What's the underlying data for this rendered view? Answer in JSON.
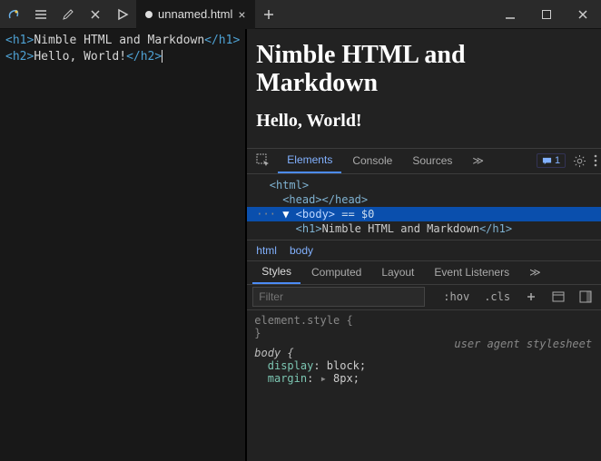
{
  "titlebar": {
    "tab_label": "unnamed.html",
    "tab_modified": true
  },
  "editor": {
    "lines": [
      {
        "open": "<h1>",
        "text": "Nimble HTML and Markdown",
        "close": "</h1>"
      },
      {
        "open": "<h2>",
        "text": "Hello, World!",
        "close": "</h2>"
      }
    ]
  },
  "preview": {
    "h1": "Nimble HTML and Markdown",
    "h2": "Hello, World!"
  },
  "devtools": {
    "tabs": [
      "Elements",
      "Console",
      "Sources"
    ],
    "active_tab": 0,
    "more_glyph": "≫",
    "message_count": "1",
    "dom": {
      "html_open": "<html>",
      "head": "<head></head>",
      "body_open": "<body>",
      "body_eq": " == $0",
      "h1_open": "<h1>",
      "h1_text": "Nimble HTML and Markdown",
      "h1_close": "</h1>"
    },
    "breadcrumb": [
      "html",
      "body"
    ],
    "subtabs": [
      "Styles",
      "Computed",
      "Layout",
      "Event Listeners"
    ],
    "active_subtab": 0,
    "filter_placeholder": "Filter",
    "toolbar": {
      "hov": ":hov",
      "cls": ".cls"
    },
    "styles": {
      "element_style_label": "element.style {",
      "element_style_close": "}",
      "body_rule_label": "body {",
      "uas_label": "user agent stylesheet",
      "prop1_name": "display",
      "prop1_val": "block",
      "prop2_name": "margin",
      "prop2_val": "8px"
    }
  }
}
